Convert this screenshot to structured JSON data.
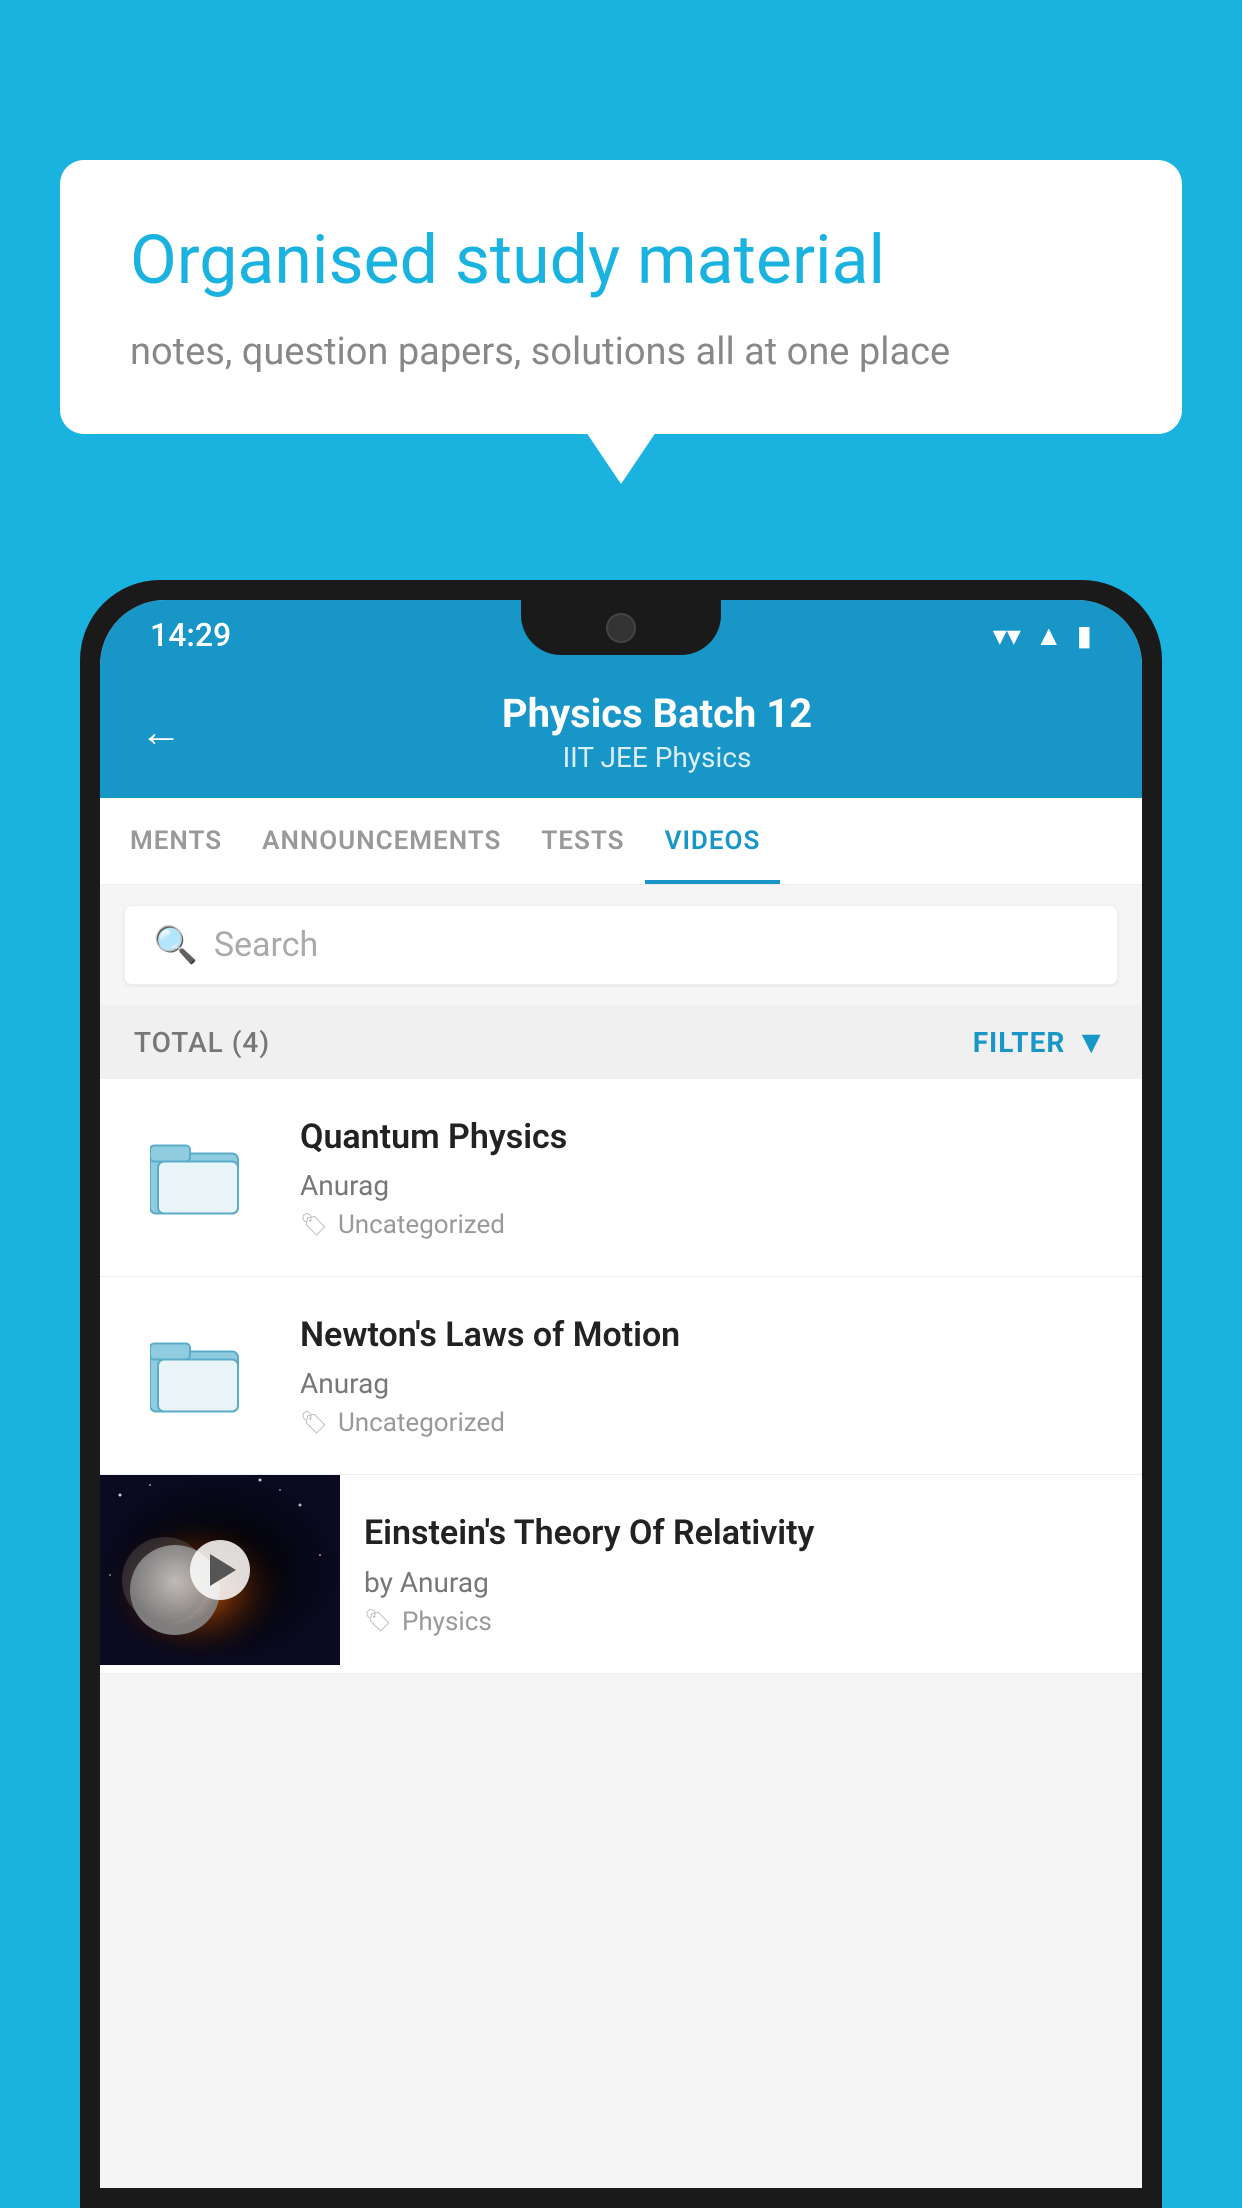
{
  "bubble": {
    "title": "Organised study material",
    "subtitle": "notes, question papers, solutions all at one place"
  },
  "statusBar": {
    "time": "14:29",
    "icons": [
      "wifi",
      "signal",
      "battery"
    ]
  },
  "header": {
    "title": "Physics Batch 12",
    "subtitle": "IIT JEE   Physics",
    "back_label": "←"
  },
  "tabs": [
    {
      "label": "MENTS",
      "active": false
    },
    {
      "label": "ANNOUNCEMENTS",
      "active": false
    },
    {
      "label": "TESTS",
      "active": false
    },
    {
      "label": "VIDEOS",
      "active": true
    }
  ],
  "search": {
    "placeholder": "Search"
  },
  "filter": {
    "total_label": "TOTAL (4)",
    "filter_label": "FILTER"
  },
  "videos": [
    {
      "title": "Quantum Physics",
      "author": "Anurag",
      "tag": "Uncategorized",
      "type": "folder"
    },
    {
      "title": "Newton's Laws of Motion",
      "author": "Anurag",
      "tag": "Uncategorized",
      "type": "folder"
    },
    {
      "title": "Einstein's Theory Of Relativity",
      "author": "by Anurag",
      "tag": "Physics",
      "type": "video"
    }
  ]
}
